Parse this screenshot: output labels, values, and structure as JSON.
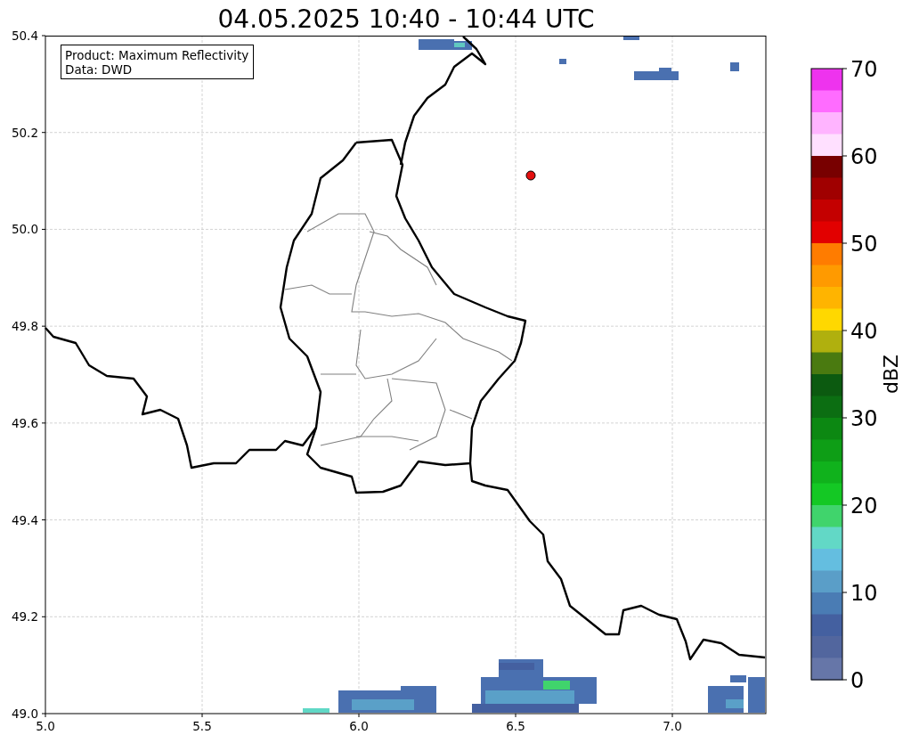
{
  "title": "04.05.2025 10:40 - 10:44 UTC",
  "legend": {
    "lines": [
      "Product: Maximum Reflectivity",
      "Data: DWD"
    ]
  },
  "map": {
    "xticks": [
      "5.0",
      "5.5",
      "6.0",
      "6.5",
      "7.0"
    ],
    "yticks": [
      "50.4",
      "50.2",
      "50.0",
      "49.8",
      "49.6",
      "49.4",
      "49.2",
      "49.0"
    ]
  },
  "colorbar": {
    "label": "dBZ",
    "ticks": [
      "70",
      "60",
      "50",
      "40",
      "30",
      "20",
      "10",
      "0"
    ],
    "bands": [
      {
        "color": "#ee33ee"
      },
      {
        "color": "#ff6cff"
      },
      {
        "color": "#ffb4ff"
      },
      {
        "color": "#ffe0ff"
      },
      {
        "color": "#780000"
      },
      {
        "color": "#a00000"
      },
      {
        "color": "#c40000"
      },
      {
        "color": "#e20000"
      },
      {
        "color": "#ff7c00"
      },
      {
        "color": "#ff9a00"
      },
      {
        "color": "#ffb400"
      },
      {
        "color": "#ffd800"
      },
      {
        "color": "#b0b00e"
      },
      {
        "color": "#4a7a10"
      },
      {
        "color": "#0c5a10"
      },
      {
        "color": "#0c6e12"
      },
      {
        "color": "#0c8812"
      },
      {
        "color": "#0e9e16"
      },
      {
        "color": "#10b21c"
      },
      {
        "color": "#14c824"
      },
      {
        "color": "#40d46c"
      },
      {
        "color": "#62d8c6"
      },
      {
        "color": "#64bee0"
      },
      {
        "color": "#5a9ec8"
      },
      {
        "color": "#4a7cb4"
      },
      {
        "color": "#4460a0"
      },
      {
        "color": "#52669e"
      },
      {
        "color": "#6676a8"
      }
    ]
  }
}
